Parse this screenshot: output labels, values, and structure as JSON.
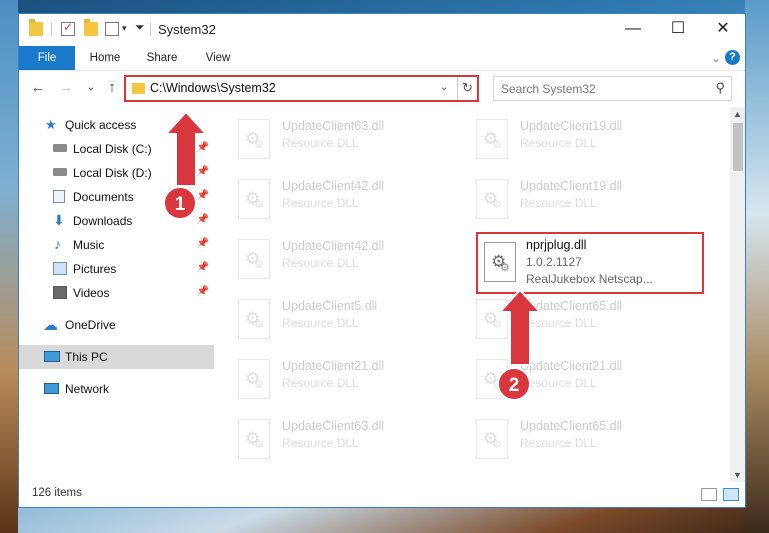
{
  "titlebar": {
    "title": "System32",
    "minimize": "—",
    "maximize": "☐",
    "close": "✕"
  },
  "ribbon": {
    "tabs": [
      "File",
      "Home",
      "Share",
      "View"
    ],
    "help": "?"
  },
  "address": {
    "path": "C:\\Windows\\System32",
    "search_placeholder": "Search System32"
  },
  "nav": {
    "items": [
      {
        "label": "Quick access",
        "icon": "star-icon",
        "pinned": false
      },
      {
        "label": "Local Disk (C:)",
        "icon": "drive-icon",
        "pinned": true
      },
      {
        "label": "Local Disk (D:)",
        "icon": "drive-icon",
        "pinned": true
      },
      {
        "label": "Documents",
        "icon": "documents-icon",
        "pinned": true
      },
      {
        "label": "Downloads",
        "icon": "download-icon",
        "pinned": true
      },
      {
        "label": "Music",
        "icon": "music-icon",
        "pinned": true
      },
      {
        "label": "Pictures",
        "icon": "pictures-icon",
        "pinned": true
      },
      {
        "label": "Videos",
        "icon": "videos-icon",
        "pinned": true
      },
      {
        "label": "OneDrive",
        "icon": "cloud-icon",
        "pinned": false
      },
      {
        "label": "This PC",
        "icon": "computer-icon",
        "pinned": false,
        "selected": true
      },
      {
        "label": "Network",
        "icon": "network-icon",
        "pinned": false
      }
    ]
  },
  "files": {
    "left": [
      {
        "name": "UpdateClient63.dll",
        "type": "Resource DLL"
      },
      {
        "name": "UpdateClient42.dll",
        "type": "Resource DLL"
      },
      {
        "name": "UpdateClient42.dll",
        "type": "Resource DLL"
      },
      {
        "name": "UpdateClient5.dll",
        "type": "Resource DLL"
      },
      {
        "name": "UpdateClient21.dll",
        "type": "Resource DLL"
      },
      {
        "name": "UpdateClient63.dll",
        "type": "Resource DLL"
      }
    ],
    "right": [
      {
        "name": "UpdateClient19.dll",
        "type": "Resource DLL"
      },
      {
        "name": "UpdateClient19.dll",
        "type": "Resource DLL"
      },
      {
        "name": "UpdateClient65.dll",
        "type": "Resource DLL"
      },
      {
        "name": "UpdateClient21.dll",
        "type": "Resource DLL"
      },
      {
        "name": "UpdateClient65.dll",
        "type": "Resource DLL"
      }
    ],
    "highlighted": {
      "name": "nprjplug.dll",
      "version": "1.0.2.1127",
      "description": "RealJukebox Netscap..."
    }
  },
  "status": {
    "item_count": "126 items"
  },
  "annotations": {
    "step1": "1",
    "step2": "2",
    "color": "#d9363e"
  }
}
